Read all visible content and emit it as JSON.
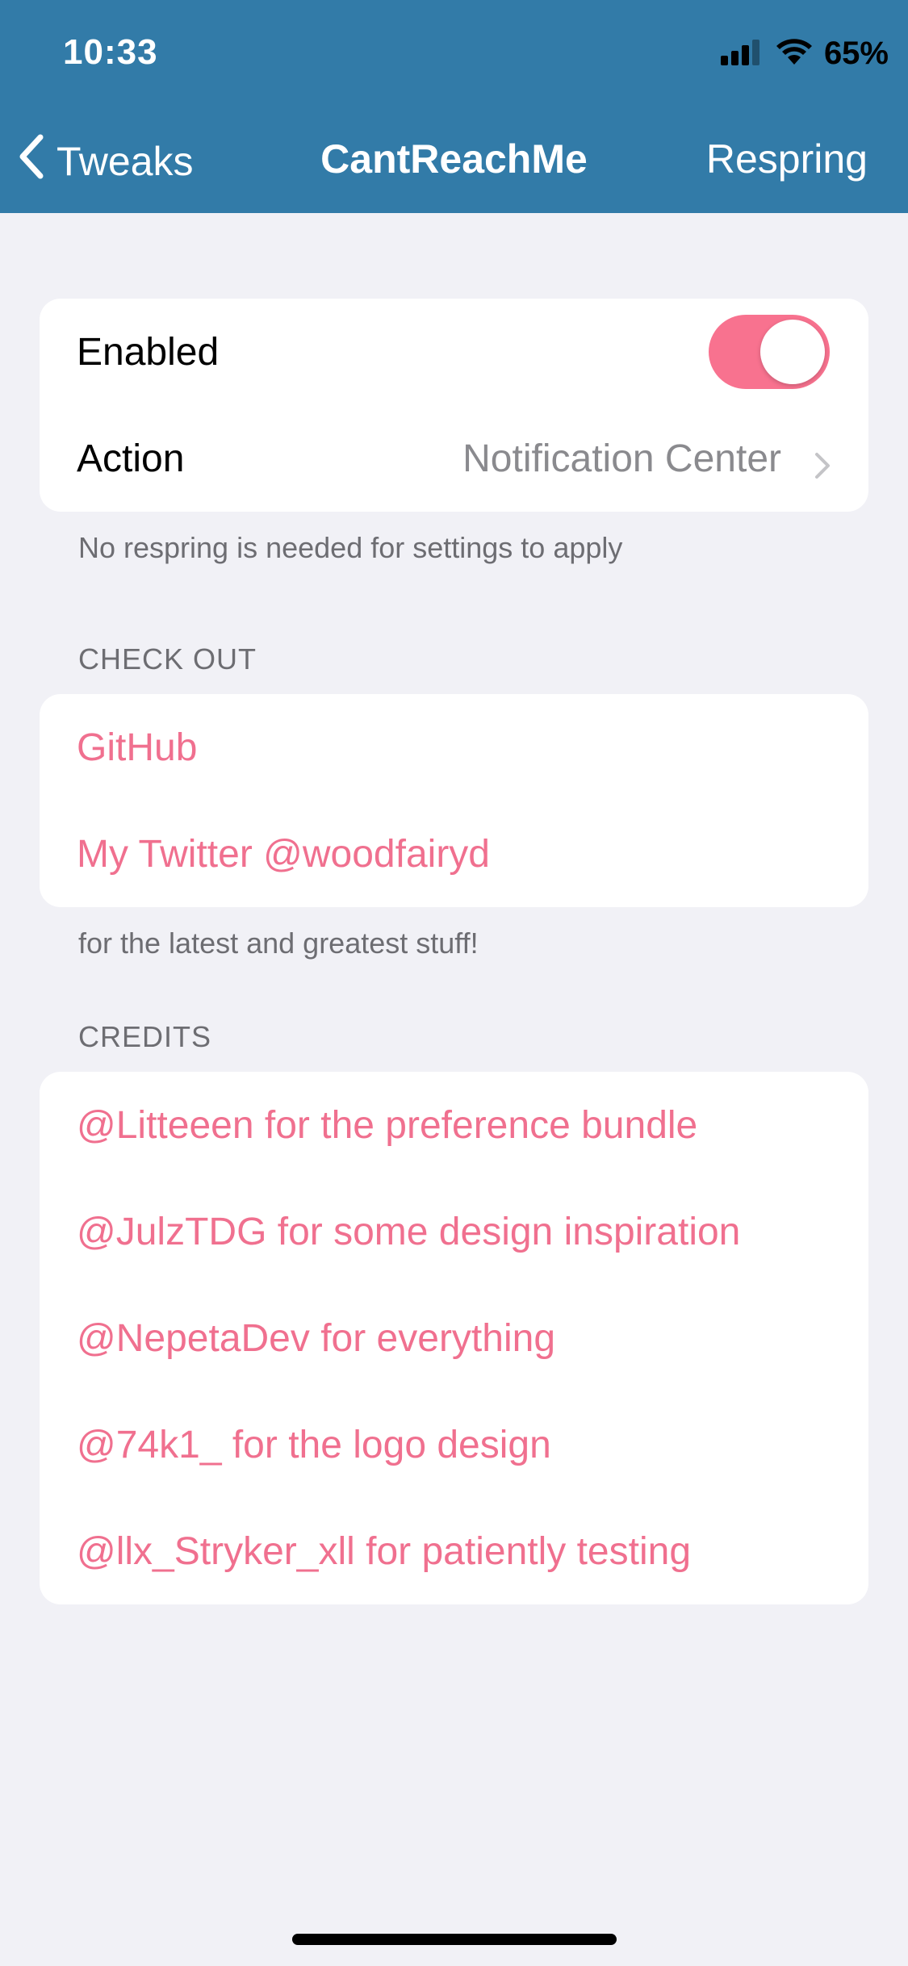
{
  "status": {
    "time": "10:33",
    "battery": "65%"
  },
  "nav": {
    "back_label": "Tweaks",
    "title": "CantReachMe",
    "right_button": "Respring"
  },
  "settings": {
    "enabled_label": "Enabled",
    "enabled_on": true,
    "action_label": "Action",
    "action_value": "Notification Center",
    "footer": "No respring is needed for settings to apply"
  },
  "check_out": {
    "header": "CHECK OUT",
    "items": [
      {
        "label": "GitHub"
      },
      {
        "label": "My Twitter @woodfairyd"
      }
    ],
    "footer": "for the latest and greatest stuff!"
  },
  "credits": {
    "header": "CREDITS",
    "items": [
      {
        "label": "@Litteeen for the preference bundle"
      },
      {
        "label": "@JulzTDG for some design inspiration"
      },
      {
        "label": "@NepetaDev for everything"
      },
      {
        "label": "@74k1_ for the logo design"
      },
      {
        "label": "@llx_Stryker_xll for patiently testing"
      }
    ]
  },
  "colors": {
    "nav_background": "#327ba8",
    "accent": "#f0708f",
    "page_background": "#f1f1f6"
  },
  "icons": {
    "back": "chevron-left-icon",
    "disclosure": "chevron-right-icon",
    "signal": "cellular-signal-icon",
    "wifi": "wifi-icon"
  }
}
